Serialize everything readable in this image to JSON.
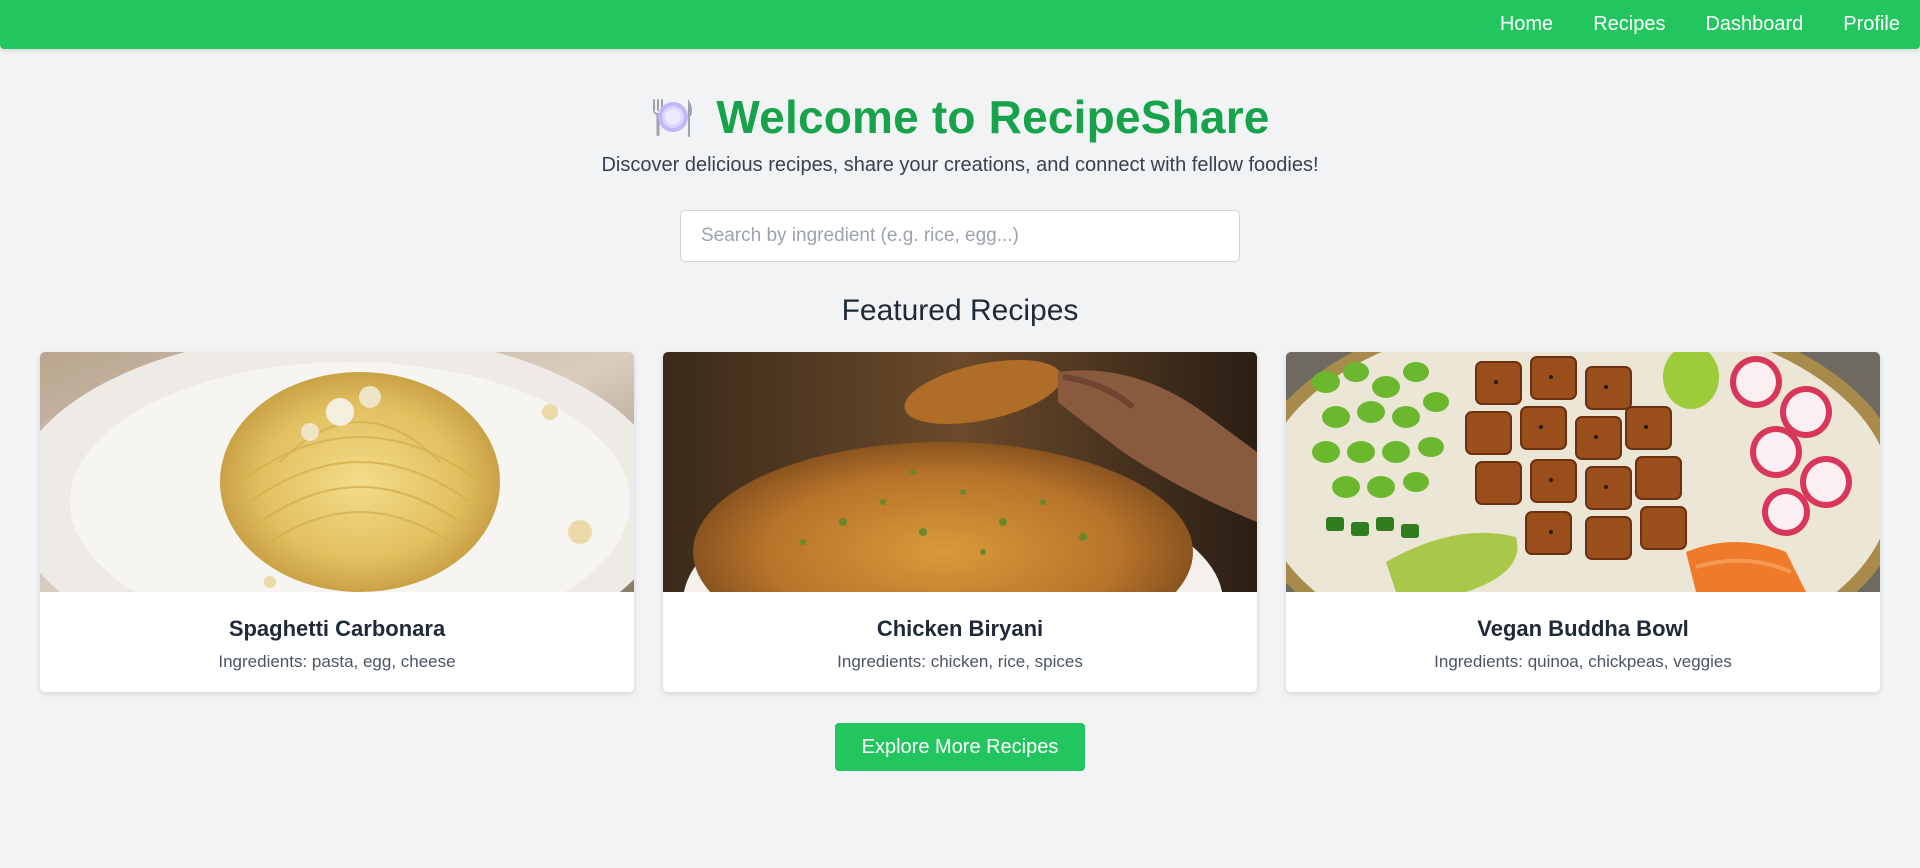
{
  "nav": {
    "links": [
      "Home",
      "Recipes",
      "Dashboard",
      "Profile"
    ]
  },
  "hero": {
    "icon": "plate-with-cutlery-icon",
    "title": "Welcome to RecipeShare",
    "subtitle": "Discover delicious recipes, share your creations, and connect with fellow foodies!"
  },
  "search": {
    "placeholder": "Search by ingredient (e.g. rice, egg...)",
    "value": ""
  },
  "featured": {
    "heading": "Featured Recipes",
    "recipes": [
      {
        "title": "Spaghetti Carbonara",
        "ingredients": "Ingredients: pasta, egg, cheese",
        "image": "spaghetti-carbonara-photo"
      },
      {
        "title": "Chicken Biryani",
        "ingredients": "Ingredients: chicken, rice, spices",
        "image": "chicken-biryani-photo"
      },
      {
        "title": "Vegan Buddha Bowl",
        "ingredients": "Ingredients: quinoa, chickpeas, veggies",
        "image": "vegan-buddha-bowl-photo"
      }
    ]
  },
  "cta": {
    "label": "Explore More Recipes"
  },
  "colors": {
    "brand_green": "#22c55e",
    "title_green": "#16a34a",
    "background": "#f2f3f5"
  }
}
